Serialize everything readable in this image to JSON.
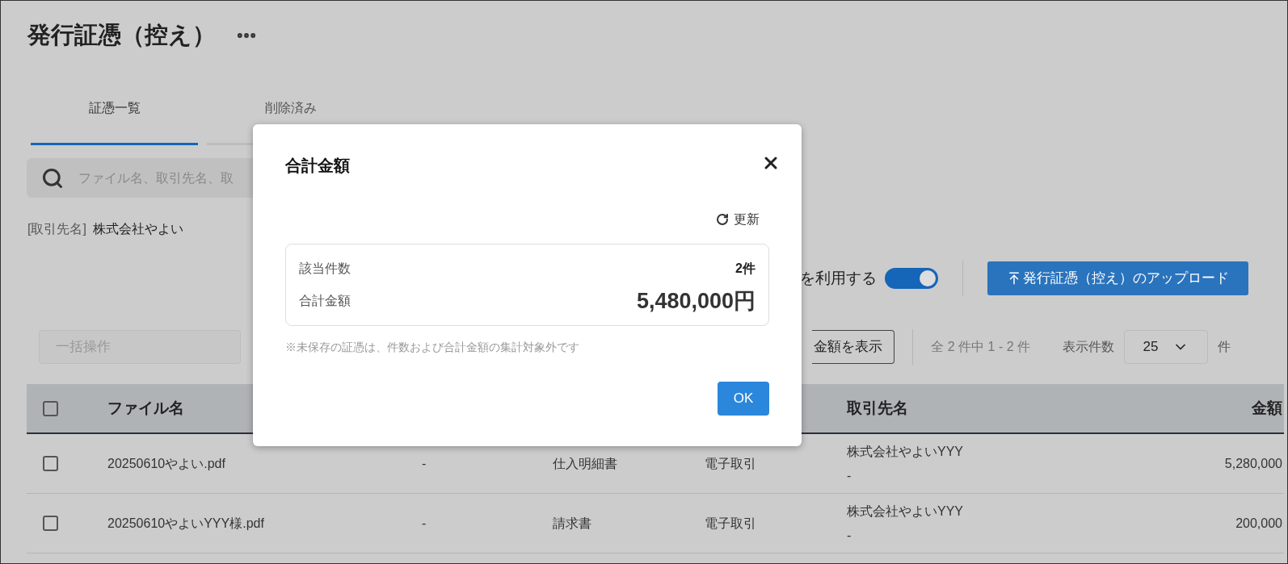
{
  "page": {
    "title": "発行証憑（控え）"
  },
  "tabs": [
    {
      "label": "証憑一覧",
      "selected": true
    },
    {
      "label": "削除済み",
      "selected": false
    }
  ],
  "search": {
    "placeholder": "ファイル名、取引先名、取"
  },
  "filter": {
    "label": "[取引先名]",
    "value": "株式会社やよい"
  },
  "toggle_row": {
    "label": "を利用する",
    "on": true
  },
  "upload_button": {
    "label": "発行証憑（控え）のアップロード"
  },
  "toolbar": {
    "bulk_action": {
      "label": "一括操作",
      "disabled": true
    },
    "total_button": {
      "label": "金額を表示"
    },
    "range": "全 2 件中 1 - 2 件",
    "per_page_label": "表示件数",
    "per_page_value": "25",
    "per_page_unit": "件"
  },
  "table": {
    "header": {
      "all_checked": false,
      "file_name": "ファイル名",
      "partner": "取引先名",
      "amount": "金額"
    },
    "rows": [
      {
        "checked": false,
        "file_name": "20250610やよい.pdf",
        "column_3": "-",
        "column_4": "仕入明細書",
        "column_5": "電子取引",
        "partner": "株式会社やよいYYY",
        "partner_sub": "-",
        "amount": "5,280,000"
      },
      {
        "checked": false,
        "file_name": "20250610やよいYYY様.pdf",
        "column_3": "-",
        "column_4": "請求書",
        "column_5": "電子取引",
        "partner": "株式会社やよいYYY",
        "partner_sub": "-",
        "amount": "200,000"
      }
    ]
  },
  "dialog": {
    "title": "合計金額",
    "refresh": "更新",
    "summary": [
      {
        "label": "該当件数",
        "value": "2件",
        "kind": "count"
      },
      {
        "label": "合計金額",
        "value": "5,480,000円",
        "kind": "total"
      }
    ],
    "note": "※未保存の証憑は、件数および合計金額の集計対象外です",
    "ok": "OK"
  }
}
